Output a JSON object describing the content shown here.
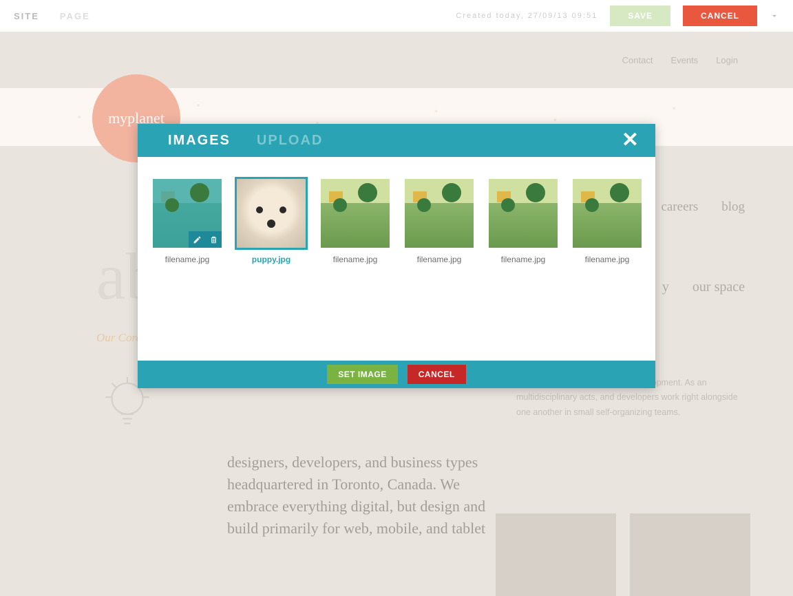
{
  "cms": {
    "tabs": {
      "site": "SITE",
      "page": "PAGE"
    },
    "meta": "Created today, 27/09/13 09:51",
    "save": "SAVE",
    "cancel": "CANCEL"
  },
  "site": {
    "logo": "myplanet",
    "topnav": {
      "contact": "Contact",
      "events": "Events",
      "login": "Login"
    },
    "nav2": {
      "careers": "careers",
      "blog": "blog"
    },
    "nav3": {
      "a": "y",
      "b": "our space"
    },
    "about": "ab",
    "core": "Our Core",
    "body": "designers, developers, and business types headquartered in Toronto, Canada. We embrace everything digital, but design and build primarily for web, mobile, and tablet",
    "side": "for our clients connection and development. As an multidisciplinary acts, and developers work right alongside one another in small self-organizing teams."
  },
  "modal": {
    "tabs": {
      "images": "IMAGES",
      "upload": "UPLOAD"
    },
    "thumbs": [
      {
        "file": "filename.jpg",
        "state": "hover"
      },
      {
        "file": "puppy.jpg",
        "state": "selected"
      },
      {
        "file": "filename.jpg",
        "state": ""
      },
      {
        "file": "filename.jpg",
        "state": ""
      },
      {
        "file": "filename.jpg",
        "state": ""
      },
      {
        "file": "filename.jpg",
        "state": ""
      }
    ],
    "set": "SET IMAGE",
    "cancel": "CANCEL"
  }
}
